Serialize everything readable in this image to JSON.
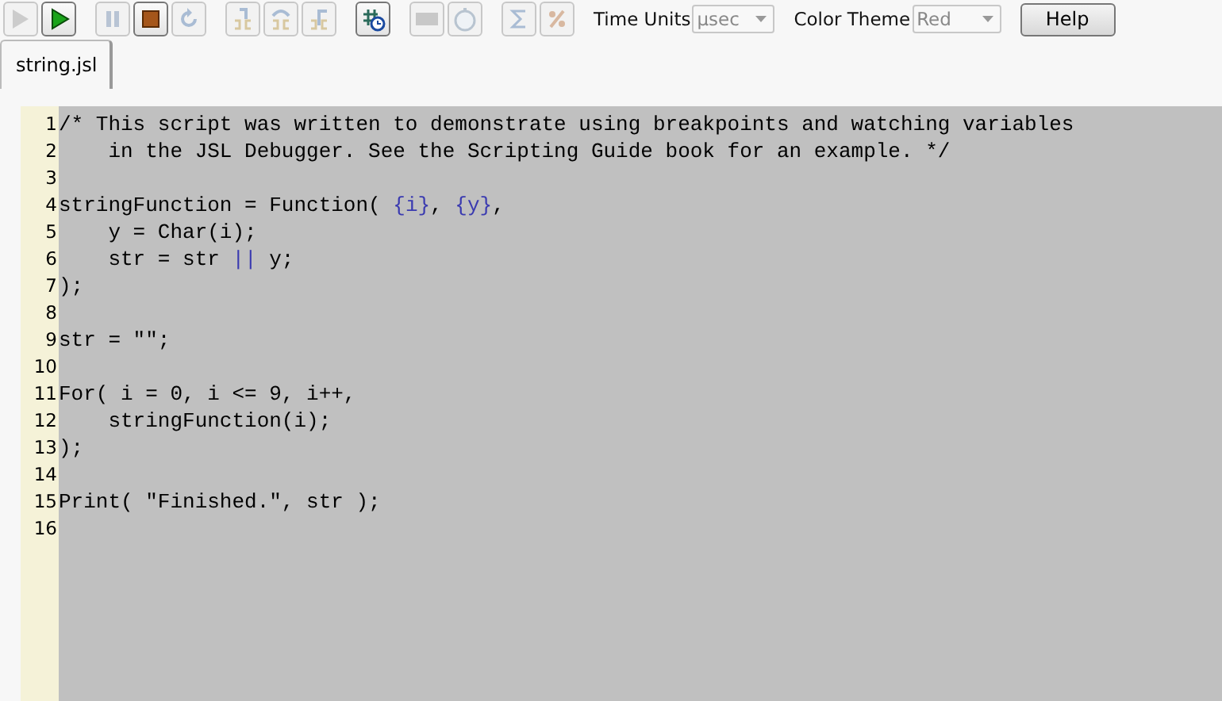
{
  "toolbar": {
    "groups": [
      [
        {
          "kind": "run",
          "disabled": true
        },
        {
          "kind": "step-run",
          "disabled": false
        }
      ],
      [
        {
          "kind": "pause",
          "disabled": true
        },
        {
          "kind": "stop",
          "disabled": false
        },
        {
          "kind": "restart",
          "disabled": true
        }
      ],
      [
        {
          "kind": "step-into",
          "disabled": true
        },
        {
          "kind": "step-over",
          "disabled": true
        },
        {
          "kind": "step-out",
          "disabled": true
        }
      ],
      [
        {
          "kind": "profile",
          "disabled": false
        }
      ],
      [
        {
          "kind": "counter",
          "disabled": true
        },
        {
          "kind": "timer",
          "disabled": true
        }
      ],
      [
        {
          "kind": "sum",
          "disabled": true
        },
        {
          "kind": "percent",
          "disabled": true
        }
      ]
    ],
    "time_units": {
      "label": "Time Units",
      "value": "µsec"
    },
    "color_theme": {
      "label": "Color Theme",
      "value": "Red"
    },
    "help": "Help"
  },
  "tabs": [
    {
      "label": "string.jsl",
      "selected": true
    }
  ],
  "editor": {
    "lines": [
      {
        "number": "1",
        "tokens": [
          {
            "kind": "plain",
            "text": "/* This script was written to demonstrate using breakpoints and watching variables"
          }
        ]
      },
      {
        "number": "2",
        "tokens": [
          {
            "kind": "plain",
            "text": "    in the JSL Debugger. See the Scripting Guide book for an example. */"
          }
        ]
      },
      {
        "number": "3"
      },
      {
        "number": "4",
        "tokens": [
          {
            "kind": "plain",
            "text": "stringFunction = Function( "
          },
          {
            "kind": "symbol",
            "text": "{i}"
          },
          {
            "kind": "plain",
            "text": ", "
          },
          {
            "kind": "symbol",
            "text": "{y}"
          },
          {
            "kind": "plain",
            "text": ","
          }
        ]
      },
      {
        "number": "5",
        "tokens": [
          {
            "kind": "plain",
            "text": "    y = Char(i);"
          }
        ]
      },
      {
        "number": "6",
        "tokens": [
          {
            "kind": "plain",
            "text": "    str = str "
          },
          {
            "kind": "symbol",
            "text": "||"
          },
          {
            "kind": "plain",
            "text": " y;"
          }
        ]
      },
      {
        "number": "7",
        "tokens": [
          {
            "kind": "plain",
            "text": ");"
          }
        ]
      },
      {
        "number": "8"
      },
      {
        "number": "9",
        "tokens": [
          {
            "kind": "plain",
            "text": "str = \"\";"
          }
        ]
      },
      {
        "number": "10"
      },
      {
        "number": "11",
        "tokens": [
          {
            "kind": "plain",
            "text": "For( i = 0, i <= 9, i++,"
          }
        ]
      },
      {
        "number": "12",
        "tokens": [
          {
            "kind": "plain",
            "text": "    stringFunction(i);"
          }
        ]
      },
      {
        "number": "13",
        "tokens": [
          {
            "kind": "plain",
            "text": ");"
          }
        ]
      },
      {
        "number": "14"
      },
      {
        "number": "15",
        "tokens": [
          {
            "kind": "plain",
            "text": "Print( \"Finished.\", str );"
          }
        ]
      },
      {
        "number": "16"
      }
    ]
  }
}
